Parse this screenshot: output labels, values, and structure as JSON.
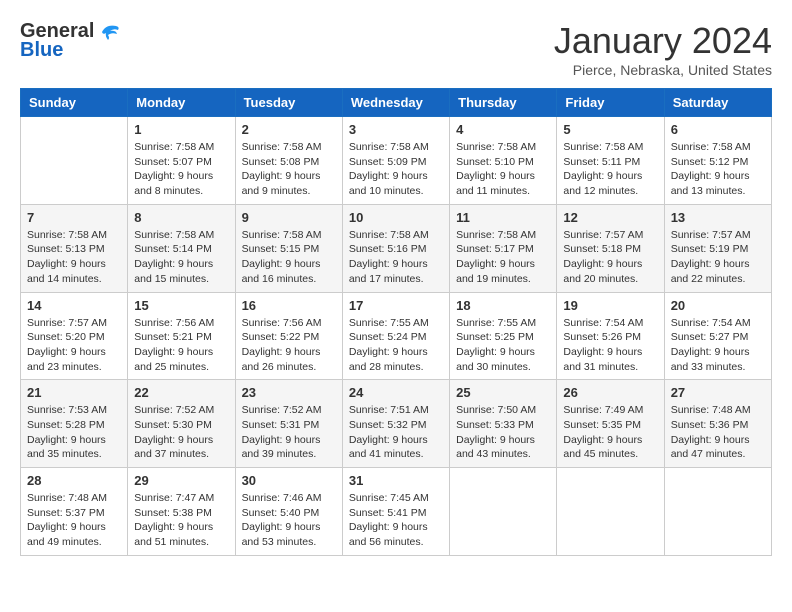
{
  "header": {
    "logo_line1": "General",
    "logo_line2": "Blue",
    "month_title": "January 2024",
    "location": "Pierce, Nebraska, United States"
  },
  "weekdays": [
    "Sunday",
    "Monday",
    "Tuesday",
    "Wednesday",
    "Thursday",
    "Friday",
    "Saturday"
  ],
  "weeks": [
    [
      {
        "day": "",
        "sunrise": "",
        "sunset": "",
        "daylight": ""
      },
      {
        "day": "1",
        "sunrise": "Sunrise: 7:58 AM",
        "sunset": "Sunset: 5:07 PM",
        "daylight": "Daylight: 9 hours and 8 minutes."
      },
      {
        "day": "2",
        "sunrise": "Sunrise: 7:58 AM",
        "sunset": "Sunset: 5:08 PM",
        "daylight": "Daylight: 9 hours and 9 minutes."
      },
      {
        "day": "3",
        "sunrise": "Sunrise: 7:58 AM",
        "sunset": "Sunset: 5:09 PM",
        "daylight": "Daylight: 9 hours and 10 minutes."
      },
      {
        "day": "4",
        "sunrise": "Sunrise: 7:58 AM",
        "sunset": "Sunset: 5:10 PM",
        "daylight": "Daylight: 9 hours and 11 minutes."
      },
      {
        "day": "5",
        "sunrise": "Sunrise: 7:58 AM",
        "sunset": "Sunset: 5:11 PM",
        "daylight": "Daylight: 9 hours and 12 minutes."
      },
      {
        "day": "6",
        "sunrise": "Sunrise: 7:58 AM",
        "sunset": "Sunset: 5:12 PM",
        "daylight": "Daylight: 9 hours and 13 minutes."
      }
    ],
    [
      {
        "day": "7",
        "sunrise": "Sunrise: 7:58 AM",
        "sunset": "Sunset: 5:13 PM",
        "daylight": "Daylight: 9 hours and 14 minutes."
      },
      {
        "day": "8",
        "sunrise": "Sunrise: 7:58 AM",
        "sunset": "Sunset: 5:14 PM",
        "daylight": "Daylight: 9 hours and 15 minutes."
      },
      {
        "day": "9",
        "sunrise": "Sunrise: 7:58 AM",
        "sunset": "Sunset: 5:15 PM",
        "daylight": "Daylight: 9 hours and 16 minutes."
      },
      {
        "day": "10",
        "sunrise": "Sunrise: 7:58 AM",
        "sunset": "Sunset: 5:16 PM",
        "daylight": "Daylight: 9 hours and 17 minutes."
      },
      {
        "day": "11",
        "sunrise": "Sunrise: 7:58 AM",
        "sunset": "Sunset: 5:17 PM",
        "daylight": "Daylight: 9 hours and 19 minutes."
      },
      {
        "day": "12",
        "sunrise": "Sunrise: 7:57 AM",
        "sunset": "Sunset: 5:18 PM",
        "daylight": "Daylight: 9 hours and 20 minutes."
      },
      {
        "day": "13",
        "sunrise": "Sunrise: 7:57 AM",
        "sunset": "Sunset: 5:19 PM",
        "daylight": "Daylight: 9 hours and 22 minutes."
      }
    ],
    [
      {
        "day": "14",
        "sunrise": "Sunrise: 7:57 AM",
        "sunset": "Sunset: 5:20 PM",
        "daylight": "Daylight: 9 hours and 23 minutes."
      },
      {
        "day": "15",
        "sunrise": "Sunrise: 7:56 AM",
        "sunset": "Sunset: 5:21 PM",
        "daylight": "Daylight: 9 hours and 25 minutes."
      },
      {
        "day": "16",
        "sunrise": "Sunrise: 7:56 AM",
        "sunset": "Sunset: 5:22 PM",
        "daylight": "Daylight: 9 hours and 26 minutes."
      },
      {
        "day": "17",
        "sunrise": "Sunrise: 7:55 AM",
        "sunset": "Sunset: 5:24 PM",
        "daylight": "Daylight: 9 hours and 28 minutes."
      },
      {
        "day": "18",
        "sunrise": "Sunrise: 7:55 AM",
        "sunset": "Sunset: 5:25 PM",
        "daylight": "Daylight: 9 hours and 30 minutes."
      },
      {
        "day": "19",
        "sunrise": "Sunrise: 7:54 AM",
        "sunset": "Sunset: 5:26 PM",
        "daylight": "Daylight: 9 hours and 31 minutes."
      },
      {
        "day": "20",
        "sunrise": "Sunrise: 7:54 AM",
        "sunset": "Sunset: 5:27 PM",
        "daylight": "Daylight: 9 hours and 33 minutes."
      }
    ],
    [
      {
        "day": "21",
        "sunrise": "Sunrise: 7:53 AM",
        "sunset": "Sunset: 5:28 PM",
        "daylight": "Daylight: 9 hours and 35 minutes."
      },
      {
        "day": "22",
        "sunrise": "Sunrise: 7:52 AM",
        "sunset": "Sunset: 5:30 PM",
        "daylight": "Daylight: 9 hours and 37 minutes."
      },
      {
        "day": "23",
        "sunrise": "Sunrise: 7:52 AM",
        "sunset": "Sunset: 5:31 PM",
        "daylight": "Daylight: 9 hours and 39 minutes."
      },
      {
        "day": "24",
        "sunrise": "Sunrise: 7:51 AM",
        "sunset": "Sunset: 5:32 PM",
        "daylight": "Daylight: 9 hours and 41 minutes."
      },
      {
        "day": "25",
        "sunrise": "Sunrise: 7:50 AM",
        "sunset": "Sunset: 5:33 PM",
        "daylight": "Daylight: 9 hours and 43 minutes."
      },
      {
        "day": "26",
        "sunrise": "Sunrise: 7:49 AM",
        "sunset": "Sunset: 5:35 PM",
        "daylight": "Daylight: 9 hours and 45 minutes."
      },
      {
        "day": "27",
        "sunrise": "Sunrise: 7:48 AM",
        "sunset": "Sunset: 5:36 PM",
        "daylight": "Daylight: 9 hours and 47 minutes."
      }
    ],
    [
      {
        "day": "28",
        "sunrise": "Sunrise: 7:48 AM",
        "sunset": "Sunset: 5:37 PM",
        "daylight": "Daylight: 9 hours and 49 minutes."
      },
      {
        "day": "29",
        "sunrise": "Sunrise: 7:47 AM",
        "sunset": "Sunset: 5:38 PM",
        "daylight": "Daylight: 9 hours and 51 minutes."
      },
      {
        "day": "30",
        "sunrise": "Sunrise: 7:46 AM",
        "sunset": "Sunset: 5:40 PM",
        "daylight": "Daylight: 9 hours and 53 minutes."
      },
      {
        "day": "31",
        "sunrise": "Sunrise: 7:45 AM",
        "sunset": "Sunset: 5:41 PM",
        "daylight": "Daylight: 9 hours and 56 minutes."
      },
      {
        "day": "",
        "sunrise": "",
        "sunset": "",
        "daylight": ""
      },
      {
        "day": "",
        "sunrise": "",
        "sunset": "",
        "daylight": ""
      },
      {
        "day": "",
        "sunrise": "",
        "sunset": "",
        "daylight": ""
      }
    ]
  ]
}
